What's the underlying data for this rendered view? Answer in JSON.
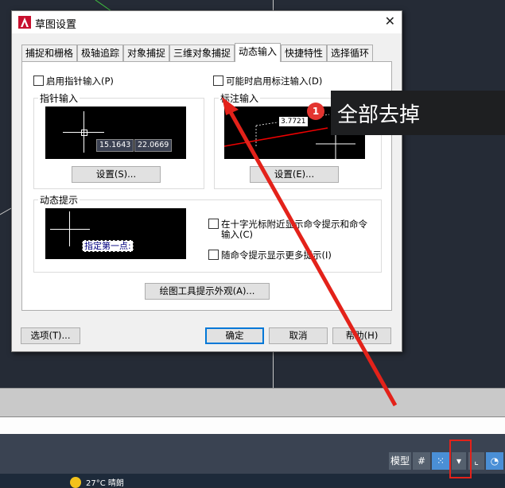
{
  "dialog": {
    "title": "草图设置",
    "tabs": [
      "捕捉和栅格",
      "极轴追踪",
      "对象捕捉",
      "三维对象捕捉",
      "动态输入",
      "快捷特性",
      "选择循环"
    ],
    "enable_pointer_input": "启用指针输入(P)",
    "enable_dimension_input": "可能时启用标注输入(D)",
    "pointer_input_group": "指针输入",
    "dimension_input_group": "标注输入",
    "pointer_coord_x": "15.1643",
    "pointer_coord_y": "22.0669",
    "dimension_value": "3.7721",
    "settings_s_button": "设置(S)...",
    "settings_e_button": "设置(E)...",
    "dynamic_prompt_group": "动态提示",
    "show_prompt_near_crosshair": "在十字光标附近显示命令提示和命令",
    "show_prompt_near_crosshair_2": "输入(C)",
    "show_more_tips": "随命令提示显示更多提示(I)",
    "dynamic_prompt_text": "指定第一点:",
    "drafting_tooltip_button": "绘图工具提示外观(A)...",
    "options_button": "选项(T)...",
    "ok_button": "确定",
    "cancel_button": "取消",
    "help_button": "帮助(H)"
  },
  "annotation": {
    "badge": "1",
    "text": "全部去掉"
  },
  "statusbar": {
    "model_label": "模型"
  },
  "taskbar": {
    "weather": "27°C  晴朗"
  },
  "colors": {
    "annotation_red": "#e3221a",
    "accent": "#0078d7"
  }
}
